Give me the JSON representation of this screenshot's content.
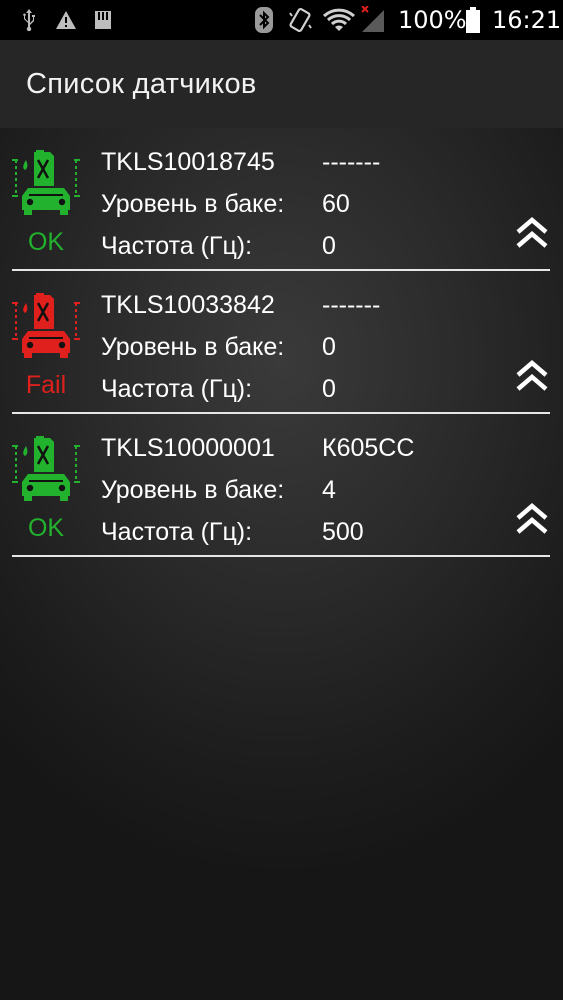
{
  "status_bar": {
    "battery_percent": "100%",
    "time": "16:21",
    "icons": [
      "usb-icon",
      "warning-icon",
      "sd-card-icon",
      "bluetooth-icon",
      "vibrate-icon",
      "wifi-icon",
      "signal-icon",
      "battery-icon"
    ]
  },
  "app_bar": {
    "title": "Список датчиков"
  },
  "sensors": [
    {
      "id": "TKLS10018745",
      "vehicle": "-------",
      "level_label": "Уровень в баке:",
      "level_value": "60",
      "freq_label": "Частота (Гц):",
      "freq_value": "0",
      "status": "OK",
      "status_color": "#22b22e",
      "icon": "fuel-car-icon"
    },
    {
      "id": "TKLS10033842",
      "vehicle": "-------",
      "level_label": "Уровень в баке:",
      "level_value": "0",
      "freq_label": "Частота (Гц):",
      "freq_value": "0",
      "status": "Fail",
      "status_color": "#e0201c",
      "icon": "fuel-car-icon"
    },
    {
      "id": "TKLS10000001",
      "vehicle": "К605СС",
      "level_label": "Уровень в баке:",
      "level_value": "4",
      "freq_label": "Частота (Гц):",
      "freq_value": "500",
      "status": "OK",
      "status_color": "#22b22e",
      "icon": "fuel-car-icon"
    }
  ],
  "colors": {
    "ok": "#22b22e",
    "fail": "#e0201c",
    "divider": "#e6e6e6",
    "app_bar": "#262626"
  }
}
